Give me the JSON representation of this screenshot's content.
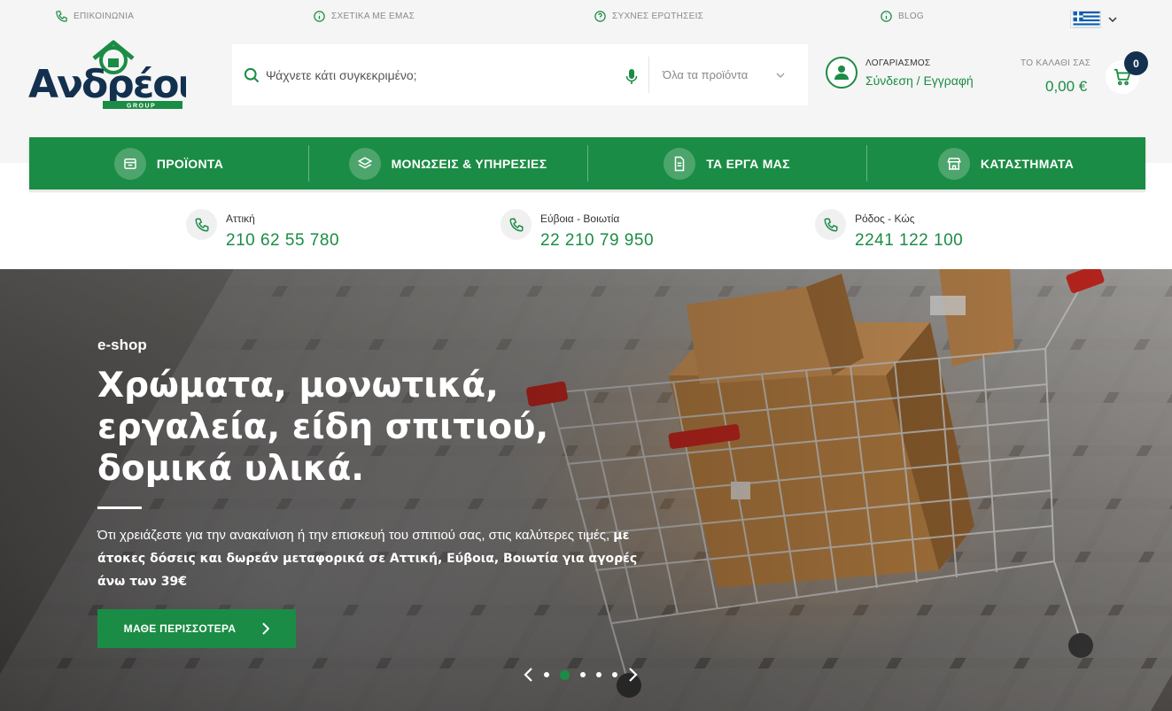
{
  "topbar": {
    "contact": "ΕΠΙΚΟΙΝΩΝΙΑ",
    "about": "ΣΧΕΤΙΚΑ ΜΕ ΕΜΑΣ",
    "faq": "ΣΥΧΝΕΣ ΕΡΩΤΗΣΕΙΣ",
    "blog": "BLOG",
    "language": "greek-flag-icon"
  },
  "brand": {
    "name": "Ανδρέου",
    "sub": "GROUP"
  },
  "search": {
    "placeholder": "Ψάχνετε κάτι συγκεκριμένο;",
    "category": "Όλα τα προϊόντα"
  },
  "account": {
    "label": "ΛΟΓΑΡΙΑΣΜΟΣ",
    "link": "Σύνδεση / Εγγραφή"
  },
  "cart": {
    "label": "ΤΟ ΚΑΛΑΘΙ ΣΑΣ",
    "total": "0,00 €",
    "count": "0"
  },
  "nav": [
    {
      "label": "ΠΡΟΪΟΝΤΑ",
      "icon": "products-icon"
    },
    {
      "label": "ΜΟΝΩΣΕΙΣ & ΥΠΗΡΕΣΙΕΣ",
      "icon": "layers-icon"
    },
    {
      "label": "ΤΑ ΕΡΓΑ ΜΑΣ",
      "icon": "document-icon"
    },
    {
      "label": "ΚΑΤΑΣΤΗΜΑΤΑ",
      "icon": "store-icon"
    }
  ],
  "phones": [
    {
      "region": "Αττική",
      "number": "210 62 55 780"
    },
    {
      "region": "Εύβοια - Βοιωτία",
      "number": "22 210 79 950"
    },
    {
      "region": "Ρόδος - Κώς",
      "number": "2241 122 100"
    }
  ],
  "hero": {
    "eyebrow": "e-shop",
    "headline": "Χρώματα, μονωτικά, εργαλεία, είδη σπιτιού, δομικά υλικά.",
    "desc_plain": "Ότι χρειάζεστε για την ανακαίνιση ή την επισκευή του σπιτιού σας, στις καλύτερες τιμές, ",
    "desc_bold": "με άτοκες δόσεις και δωρεάν μεταφορικά σε Αττική, Εύβοια, Βοιωτία για αγορές άνω των 39€",
    "cta": "ΜΑΘΕ ΠΕΡΙΣΣΟΤΕΡΑ",
    "slides_total": 5,
    "active_slide": 2
  },
  "colors": {
    "brand_green": "#1b8c45",
    "navy": "#13314f"
  }
}
